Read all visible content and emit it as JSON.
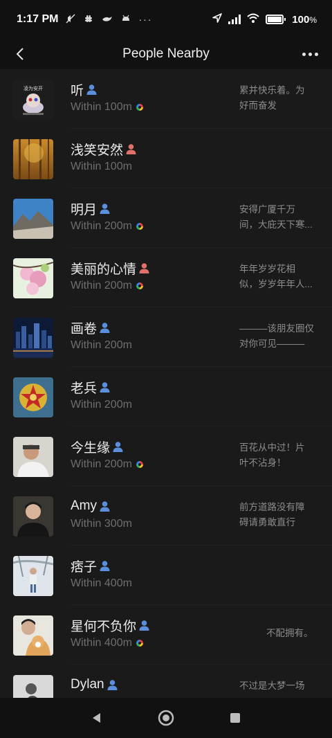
{
  "status_bar": {
    "time": "1:17 PM",
    "battery": "100"
  },
  "nav": {
    "title": "People Nearby"
  },
  "people": [
    {
      "name": "听",
      "gender": "male",
      "distance": "Within 100m",
      "has_moments": true,
      "signature": [
        "累并快乐着。为",
        "好而奋发"
      ]
    },
    {
      "name": "浅笑安然",
      "gender": "female",
      "distance": "Within 100m",
      "has_moments": false,
      "signature": []
    },
    {
      "name": "明月",
      "gender": "male",
      "distance": "Within 200m",
      "has_moments": true,
      "signature": [
        "安得广厦千万",
        "间，大庇天下寒..."
      ]
    },
    {
      "name": "美丽的心情",
      "gender": "female",
      "distance": "Within 200m",
      "has_moments": true,
      "signature": [
        "年年岁岁花相",
        "似，岁岁年年人..."
      ]
    },
    {
      "name": "画卷",
      "gender": "male",
      "distance": "Within 200m",
      "has_moments": false,
      "signature": [
        "———该朋友圈仅",
        "对你可见———"
      ]
    },
    {
      "name": "老兵",
      "gender": "male",
      "distance": "Within 200m",
      "has_moments": false,
      "signature": []
    },
    {
      "name": "今生缘",
      "gender": "male",
      "distance": "Within 200m",
      "has_moments": true,
      "signature": [
        "百花从中过！片",
        "叶不沾身！"
      ]
    },
    {
      "name": "Amy",
      "gender": "male",
      "distance": "Within 300m",
      "has_moments": false,
      "signature": [
        "前方道路没有障",
        "碍请勇敢直行"
      ]
    },
    {
      "name": "痞子",
      "gender": "male",
      "distance": "Within 400m",
      "has_moments": false,
      "signature": []
    },
    {
      "name": "星何不负你",
      "gender": "male",
      "distance": "Within 400m",
      "has_moments": true,
      "signature": [
        "不配拥有。"
      ]
    },
    {
      "name": "Dylan",
      "gender": "male",
      "distance": "",
      "has_moments": false,
      "signature": [
        "不过是大梦一场"
      ]
    }
  ],
  "avatar_text": {
    "ting_title": "凌为安开"
  },
  "colors": {
    "male": "#5b8fdc",
    "female": "#e0706a"
  }
}
